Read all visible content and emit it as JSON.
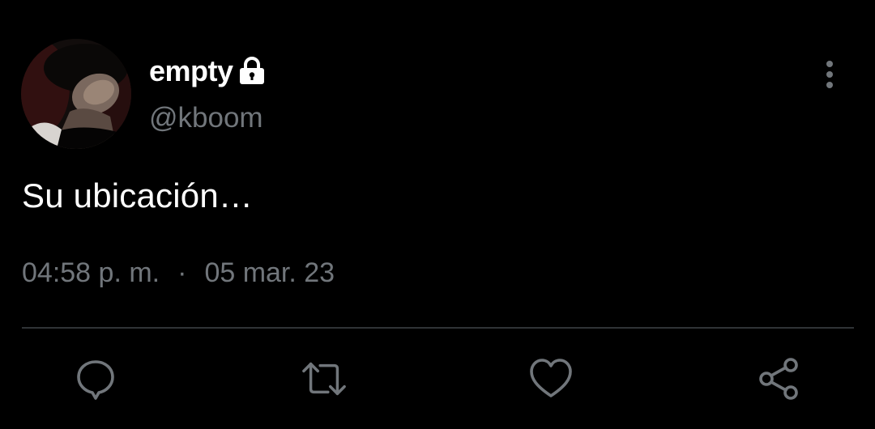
{
  "author": {
    "display_name": "empty",
    "handle": "@kboom",
    "protected": true,
    "avatar_icon": "user-avatar-photo"
  },
  "tweet": {
    "text": "Su ubicación…",
    "time": "04:58 p. m.",
    "separator": "·",
    "date": "05 mar. 23"
  },
  "actions": [
    {
      "name": "reply",
      "icon": "speech-bubble-icon"
    },
    {
      "name": "retweet",
      "icon": "retweet-icon"
    },
    {
      "name": "like",
      "icon": "heart-icon"
    },
    {
      "name": "share",
      "icon": "share-icon"
    }
  ],
  "colors": {
    "background": "#000000",
    "primary_text": "#ffffff",
    "secondary_text": "#71767b",
    "divider": "#2f3336"
  }
}
